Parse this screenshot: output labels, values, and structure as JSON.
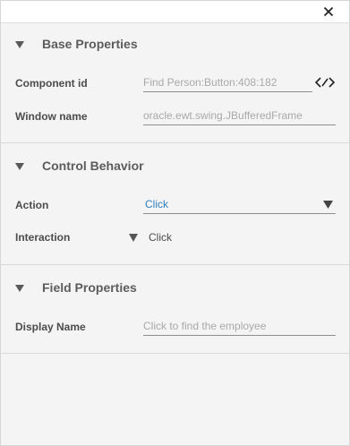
{
  "window": {
    "close_icon": "close-icon"
  },
  "sections": {
    "base": {
      "title": "Base Properties",
      "component_id_label": "Component id",
      "component_id_value": "Find Person:Button:408:182",
      "window_name_label": "Window name",
      "window_name_value": "oracle.ewt.swing.JBufferedFrame",
      "edit_icon": "code-edit-icon"
    },
    "control": {
      "title": "Control Behavior",
      "action_label": "Action",
      "action_value": "Click",
      "interaction_label": "Interaction",
      "interaction_value": "Click"
    },
    "field": {
      "title": "Field Properties",
      "display_name_label": "Display Name",
      "display_name_placeholder": "Click to find the employee"
    }
  },
  "colors": {
    "background": "#f4f4f4",
    "accent_value": "#2f7fbf",
    "muted_text": "#a9a9a9"
  }
}
